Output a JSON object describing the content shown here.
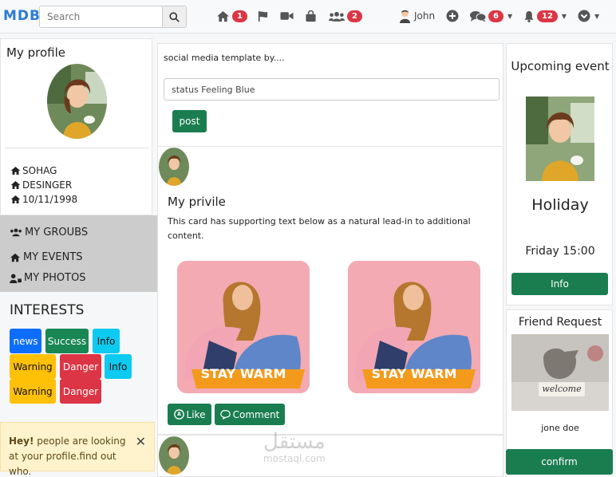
{
  "navbar": {
    "logo": "MDB",
    "search_placeholder": "Search",
    "home_badge": "1",
    "friends_badge": "2",
    "user_name": "John",
    "messages_badge": "6",
    "notifications_badge": "12"
  },
  "profile": {
    "title": "My profile",
    "name": "SOHAG",
    "job": "DESINGER",
    "birthday": "10/11/1998"
  },
  "menu": {
    "groups": "MY GROUBS",
    "events": "MY EVENTS",
    "photos": "MY PHOTOS"
  },
  "interests": {
    "title": "INTERESTS",
    "tags": [
      {
        "label": "news",
        "color": "#0d6efd"
      },
      {
        "label": "Success",
        "color": "#198754"
      },
      {
        "label": "Info",
        "color": "#0dcaf0"
      },
      {
        "label": "Warning",
        "color": "#ffc107"
      },
      {
        "label": "Danger",
        "color": "#dc3545"
      },
      {
        "label": "Info",
        "color": "#0dcaf0"
      },
      {
        "label": "Warning",
        "color": "#ffc107"
      },
      {
        "label": "Danger",
        "color": "#dc3545"
      }
    ]
  },
  "alert": {
    "bold": "Hey!",
    "text": " people are looking at your profile.find out who.",
    "close": "✕"
  },
  "post_box": {
    "intro": "social media template by....",
    "status_value": "status Feeling Blue",
    "post_button": "post"
  },
  "card": {
    "title": "My privile",
    "text": "This card has supporting text below as a natural lead-in to additional content.",
    "promo_text": "STAY WARM",
    "like_button": "Like",
    "comment_button": "Comment"
  },
  "event": {
    "title": "Upcoming event",
    "name": "Holiday",
    "time": "Friday 15:00",
    "info_button": "Info"
  },
  "friend_request": {
    "title": "Friend Request",
    "image_text": "welcome",
    "name": "jone doe",
    "confirm_button": "confirm"
  },
  "watermark": {
    "arabic": "مستقل",
    "latin": "mostaql.com"
  },
  "colors": {
    "primary_green": "#1a7d50",
    "badge_red": "#dc3545",
    "logo_blue": "#2b7bd6"
  }
}
